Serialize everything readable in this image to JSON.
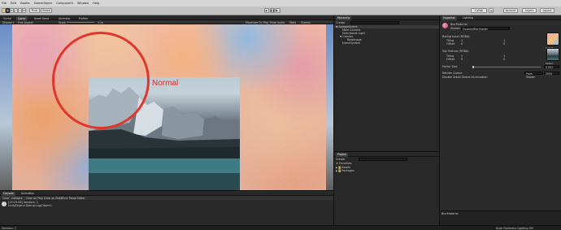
{
  "menu": [
    "File",
    "Edit",
    "Assets",
    "GameObject",
    "Component",
    "Window",
    "Help"
  ],
  "toolbar": {
    "play_icon": "play-icon",
    "pause_icon": "pause-icon",
    "step_icon": "step-icon",
    "collab": "Collab",
    "account": "Account",
    "layers": "Layers",
    "layout": "Layout",
    "pivot": "Pivot",
    "global": "Global"
  },
  "tabs": {
    "scene": "Scene",
    "game": "Game",
    "asset_store": "Asset Store",
    "animator": "Animator",
    "profiler": "Profiler"
  },
  "game_view": {
    "display": "Display 1",
    "aspect": "Free Aspect",
    "scale_label": "Scale",
    "scale_value": "4.2x",
    "maximize": "Maximize On Play",
    "mute": "Mute Audio",
    "stats": "Stats",
    "gizmos": "Gizmos"
  },
  "overlay_label": "Normal",
  "hierarchy": {
    "tab": "Hierarchy",
    "create": "Create",
    "search_placeholder": "All",
    "items": [
      {
        "label": "SampleScene",
        "depth": 0
      },
      {
        "label": "Main Camera",
        "depth": 1
      },
      {
        "label": "Directional Light",
        "depth": 1
      },
      {
        "label": "Canvas",
        "depth": 1
      },
      {
        "label": "RawImage",
        "depth": 2
      },
      {
        "label": "EventSystem",
        "depth": 1
      }
    ]
  },
  "project": {
    "tab": "Project",
    "create": "Create",
    "favorites": "Favorites",
    "items": [
      "Assets",
      "Packages"
    ]
  },
  "inspector": {
    "tab": "Inspector",
    "lighting_tab": "Lighting",
    "material_name": "BlurMaterial",
    "shader_label": "Shader",
    "shader_value": "Custom/BlurShader",
    "bg_label": "Background (RGBA)",
    "tiling_label": "Tiling",
    "offset_label": "Offset",
    "bg_tiling": [
      "1",
      "1"
    ],
    "bg_offset": [
      "0",
      "0"
    ],
    "top_label": "Top Texture (RGBA)",
    "top_tiling": [
      "1",
      "1"
    ],
    "top_offset": [
      "0",
      "0"
    ],
    "factor_label": "Factor Size",
    "factor_value": "0.052",
    "render_queue_label": "Render Queue",
    "render_queue_mode": "From Shader",
    "render_queue_value": "2000",
    "double_sided": "Double Sided Global Illumination",
    "footer": "BlurMaterial",
    "select_label": "Select"
  },
  "console": {
    "tabs": [
      "Console",
      "Animation"
    ],
    "buttons": [
      "Clear",
      "Collapse",
      "Clear on Play",
      "Clear on Build",
      "Error Pause",
      "Editor"
    ],
    "log_line1": "[15:19:08] Vendors: 1",
    "log_line2": "UnityEngine.Debug:Log(Object)"
  },
  "status": {
    "left": "Vendors: 1",
    "right": "Auto Generate Lighting Off"
  }
}
